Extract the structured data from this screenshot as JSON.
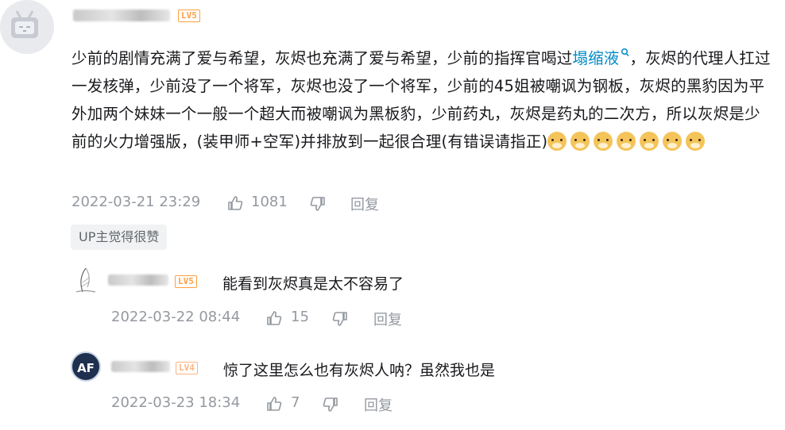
{
  "comment": {
    "level": "LV5",
    "text_before_link": "少前的剧情充满了爱与希望，灰烬也充满了爱与希望，少前的指挥官喝过",
    "link_text": "塌缩液",
    "text_after_link": "，灰烬的代理人扛过一发核弹，少前没了一个将军，灰烬也没了一个将军，少前的45姐被嘲讽为钢板，灰烬的黑豹因为平外加两个妹妹一个一般一个超大而被嘲讽为黑板豹，少前药丸，灰烬是药丸的二次方，所以灰烬是少前的火力增强版，(装甲师+空军)并排放到一起很合理(有错误请指正)",
    "timestamp": "2022-03-21 23:29",
    "likes": "1081",
    "reply_label": "回复",
    "emojis": [
      "doge-emoji",
      "doge-emoji",
      "doge-emoji",
      "doge-emoji",
      "doge-emoji",
      "doge-emoji",
      "doge-emoji"
    ]
  },
  "up_badge": "UP主觉得很赞",
  "replies": [
    {
      "level": "LV5",
      "text": "能看到灰烬真是太不容易了",
      "timestamp": "2022-03-22 08:44",
      "likes": "15",
      "reply_label": "回复"
    },
    {
      "level": "LV4",
      "avatar_text": "AF",
      "text": "惊了这里怎么也有灰烬人呐？虽然我也是",
      "timestamp": "2022-03-23 18:34",
      "likes": "7",
      "reply_label": "回复"
    }
  ],
  "colors": {
    "link": "#008ac5",
    "level_badge": "#ff9f43",
    "meta_text": "#9499a0"
  }
}
